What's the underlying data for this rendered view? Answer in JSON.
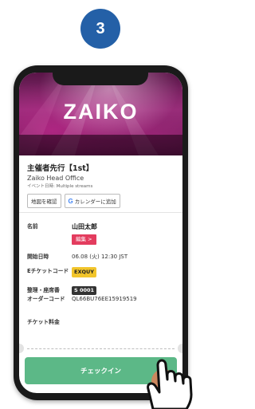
{
  "step": {
    "number": "3"
  },
  "banner": {
    "logo_text": "ZAIKO"
  },
  "event": {
    "title": "主催者先行【1st】",
    "organizer": "Zaiko Head Office",
    "date_label": "イベント日時: Multiple streams",
    "map_button": "地図を確認",
    "calendar_button_icon": "G",
    "calendar_button": "カレンダーに追加"
  },
  "details": {
    "name_label": "名前",
    "name_value": "山田太郎",
    "edit_label": "編集 >",
    "start_label": "開始日時",
    "start_value": "06.08 (火) 12:30 JST",
    "eticket_label": "Eチケットコード",
    "eticket_value": "EXQUY",
    "seat_label": "整理・座席番",
    "seat_value": "S 0001",
    "order_label": "オーダーコード",
    "order_value": "QL66BU76EE15919519",
    "fee_label": "チケット料金"
  },
  "actions": {
    "checkin_label": "チェックイン"
  },
  "colors": {
    "accent": "#2460a7",
    "checkin": "#5cb887",
    "edit": "#e33c5e",
    "code": "#f2c52b"
  }
}
